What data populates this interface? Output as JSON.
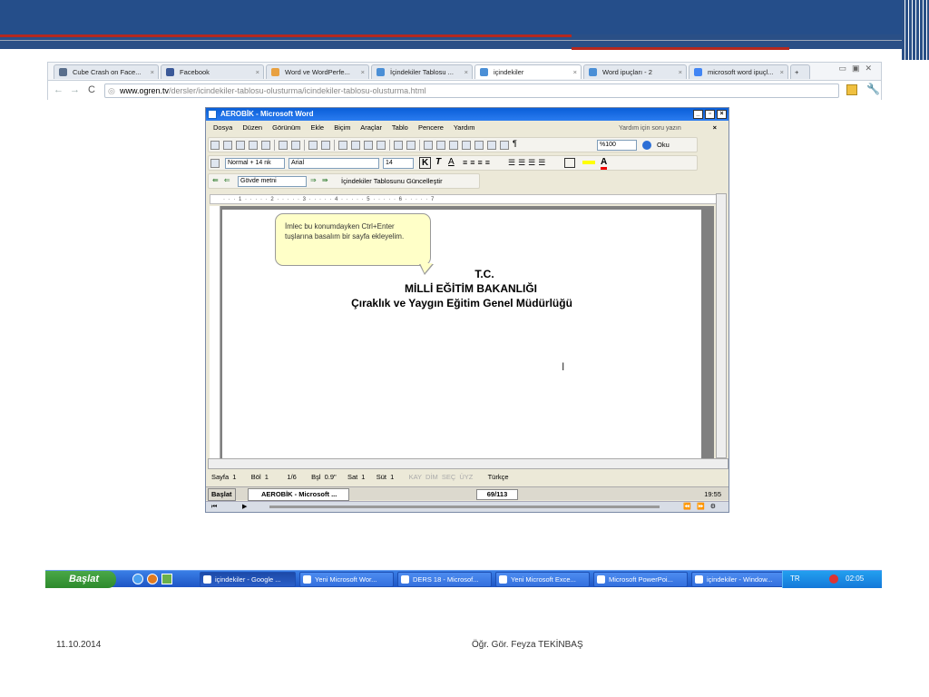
{
  "slide": {
    "footer_date": "11.10.2014",
    "footer_author": "Öğr. Gör. Feyza TEKİNBAŞ",
    "colors": {
      "header": "#254e8a",
      "accent": "#b5281e"
    }
  },
  "browser": {
    "tabs": [
      {
        "label": "Cube Crash on Face...",
        "icon": "puzzle-icon",
        "color": "#5a6f8c"
      },
      {
        "label": "Facebook",
        "icon": "facebook-icon",
        "color": "#3b5998"
      },
      {
        "label": "Word ve WordPerfe...",
        "icon": "generic-page-icon",
        "color": "#e8a040"
      },
      {
        "label": "İçindekiler Tablosu ...",
        "icon": "chrome-icon",
        "color": "#4b8fd6"
      },
      {
        "label": "içindekiler",
        "icon": "chrome-icon",
        "color": "#4b8fd6"
      },
      {
        "label": "Word ipuçları - 2",
        "icon": "chrome-icon",
        "color": "#4b8fd6"
      },
      {
        "label": "microsoft word ipuçl...",
        "icon": "google-icon",
        "color": "#4285f4"
      }
    ],
    "url_host": "www.ogren.tv",
    "url_path": "/dersler/icindekiler-tablosu-olusturma/icindekiler-tablosu-olusturma.html"
  },
  "word": {
    "title": "AEROBİK - Microsoft Word",
    "menu": [
      "Dosya",
      "Düzen",
      "Görünüm",
      "Ekle",
      "Biçim",
      "Araçlar",
      "Tablo",
      "Pencere",
      "Yardım"
    ],
    "help_placeholder": "Yardım için soru yazın",
    "zoom": "%100",
    "read_label": "Oku",
    "style": "Normal + 14 nk",
    "font": "Arial",
    "size": "14",
    "outline_level": "Gövde metni",
    "update_toc": "İçindekiler Tablosunu Güncelleştir",
    "ruler_text": "· · · 1 · · · · · 2 · · · · · 3 · · · · · 4 · · · · · 5 · · · · · 6 · · · · · 7",
    "callout": "İmlec bu konumdayken Ctrl+Enter tuşlarına basalım bir sayfa ekleyelim.",
    "doc_lines": [
      "T.C.",
      "MİLLİ  EĞİTİM  BAKANLIĞI",
      "Çıraklık ve Yaygın Eğitim Genel Müdürlüğü"
    ],
    "status": {
      "page": "Sayfa 1",
      "section": "Böl 1",
      "pages": "1/6",
      "at": "Bşl 0.9\"",
      "line": "Sat 1",
      "col": "Süt 1",
      "rec": "KAY",
      "trk": "DİM",
      "ext": "SEÇ",
      "ovr": "ÜYZ",
      "lang": "Türkçe"
    },
    "inner_start": "Başlat",
    "inner_task": "AEROBİK - Microsoft ...",
    "player_counter": "69/113",
    "inner_clock": "19:55"
  },
  "taskbar": {
    "start": "Başlat",
    "buttons": [
      "içindekiler - Google ...",
      "Yeni Microsoft Wor...",
      "DERS 18 - Microsof...",
      "Yeni Microsoft Exce...",
      "Microsoft PowerPoi...",
      "içindekiler - Window..."
    ],
    "lang": "TR",
    "clock": "02:05"
  }
}
